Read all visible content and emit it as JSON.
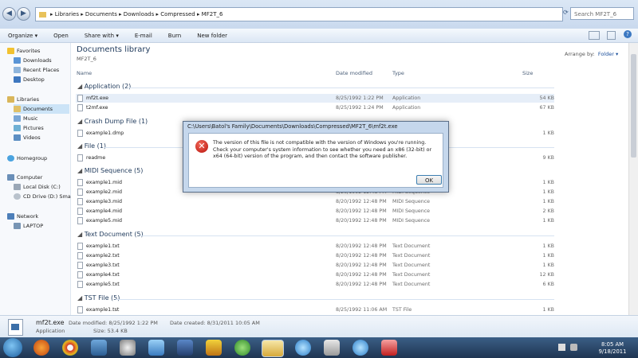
{
  "address": {
    "crumbs": "▸ Libraries ▸ Documents ▸ Downloads ▸ Compressed ▸ MF2T_6",
    "search_placeholder": "Search MF2T_6"
  },
  "toolbar": {
    "organize": "Organize ▾",
    "open": "Open",
    "share": "Share with ▾",
    "email": "E-mail",
    "burn": "Burn",
    "new_folder": "New folder"
  },
  "nav": {
    "favorites": "Favorites",
    "downloads": "Downloads",
    "recent": "Recent Places",
    "desktop": "Desktop",
    "libraries": "Libraries",
    "documents": "Documents",
    "music": "Music",
    "pictures": "Pictures",
    "videos": "Videos",
    "homegroup": "Homegroup",
    "computer": "Computer",
    "local_disk": "Local Disk (C:)",
    "cd_drive": "CD Drive (D:) Sma",
    "network": "Network",
    "laptop": "LAPTOP"
  },
  "library": {
    "title": "Documents library",
    "subtitle": "MF2T_6",
    "arrange_label": "Arrange by:",
    "arrange_value": "Folder ▾"
  },
  "columns": {
    "name": "Name",
    "date": "Date modified",
    "type": "Type",
    "size": "Size"
  },
  "groups": {
    "application": "Application (2)",
    "crash": "Crash Dump File (1)",
    "file": "File (1)",
    "midi": "MIDI Sequence (5)",
    "text": "Text Document (5)",
    "tst": "TST File (5)"
  },
  "rows": {
    "r1": {
      "name": "mf2t.exe",
      "date": "8/25/1992 1:22 PM",
      "type": "Application",
      "size": "54 KB"
    },
    "r2": {
      "name": "t2mf.exe",
      "date": "8/25/1992 1:24 PM",
      "type": "Application",
      "size": "67 KB"
    },
    "r3": {
      "name": "example1.dmp",
      "date": "",
      "type": "",
      "size": "1 KB"
    },
    "r4": {
      "name": "readme",
      "date": "",
      "type": "",
      "size": "9 KB"
    },
    "r5": {
      "name": "example1.mid",
      "date": "",
      "type": "",
      "size": "1 KB"
    },
    "r6": {
      "name": "example2.mid",
      "date": "8/20/1992 12:48 PM",
      "type": "MIDI Sequence",
      "size": "1 KB"
    },
    "r7": {
      "name": "example3.mid",
      "date": "8/20/1992 12:48 PM",
      "type": "MIDI Sequence",
      "size": "1 KB"
    },
    "r8": {
      "name": "example4.mid",
      "date": "8/20/1992 12:48 PM",
      "type": "MIDI Sequence",
      "size": "2 KB"
    },
    "r9": {
      "name": "example5.mid",
      "date": "8/20/1992 12:48 PM",
      "type": "MIDI Sequence",
      "size": "1 KB"
    },
    "r10": {
      "name": "example1.txt",
      "date": "8/20/1992 12:48 PM",
      "type": "Text Document",
      "size": "1 KB"
    },
    "r11": {
      "name": "example2.txt",
      "date": "8/20/1992 12:48 PM",
      "type": "Text Document",
      "size": "1 KB"
    },
    "r12": {
      "name": "example3.txt",
      "date": "8/20/1992 12:48 PM",
      "type": "Text Document",
      "size": "1 KB"
    },
    "r13": {
      "name": "example4.txt",
      "date": "8/20/1992 12:48 PM",
      "type": "Text Document",
      "size": "12 KB"
    },
    "r14": {
      "name": "example5.txt",
      "date": "8/20/1992 12:48 PM",
      "type": "Text Document",
      "size": "6 KB"
    },
    "r15": {
      "name": "example1.tst",
      "date": "8/25/1992 11:06 AM",
      "type": "TST File",
      "size": "1 KB"
    }
  },
  "dialog": {
    "title": "C:\\Users\\Batol's Family\\Documents\\Downloads\\Compressed\\MF2T_6\\mf2t.exe",
    "message": "The version of this file is not compatible with the version of Windows you're running. Check your computer's system information to see whether you need an x86 (32-bit) or x64 (64-bit) version of the program, and then contact the software publisher.",
    "ok": "OK"
  },
  "details": {
    "name": "mf2t.exe",
    "type": "Application",
    "modified": "Date modified: 8/25/1992 1:22 PM",
    "size": "Size: 53.4 KB",
    "created": "Date created: 8/31/2011 10:05 AM"
  },
  "clock": {
    "time": "8:05 AM",
    "date": "9/18/2011"
  }
}
